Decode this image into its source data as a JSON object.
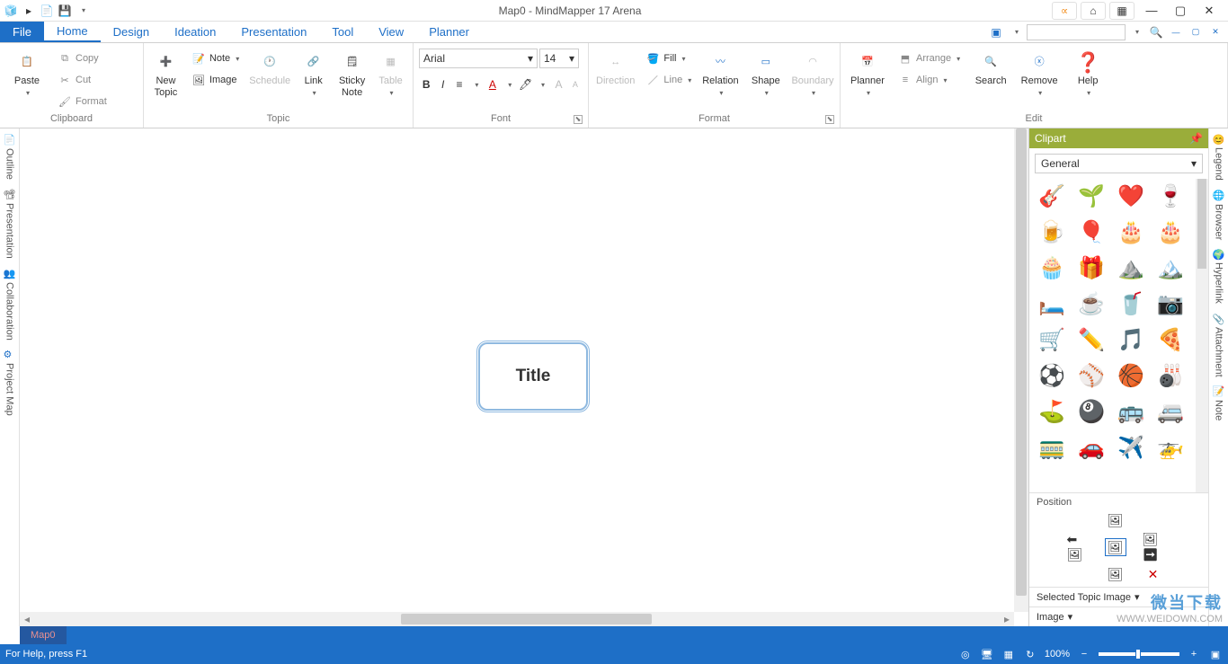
{
  "title": "Map0 - MindMapper 17 Arena",
  "tabs": {
    "file": "File",
    "home": "Home",
    "design": "Design",
    "ideation": "Ideation",
    "presentation": "Presentation",
    "tool": "Tool",
    "view": "View",
    "planner": "Planner"
  },
  "ribbon": {
    "clipboard": {
      "label": "Clipboard",
      "paste": "Paste",
      "copy": "Copy",
      "cut": "Cut",
      "format": "Format"
    },
    "topic": {
      "label": "Topic",
      "new_topic": "New\nTopic",
      "note": "Note",
      "image": "Image",
      "schedule": "Schedule",
      "link": "Link",
      "sticky": "Sticky\nNote",
      "table": "Table"
    },
    "font": {
      "label": "Font",
      "family": "Arial",
      "size": "14"
    },
    "format": {
      "label": "Format",
      "direction": "Direction",
      "fill": "Fill",
      "line": "Line",
      "relation": "Relation",
      "shape": "Shape",
      "boundary": "Boundary"
    },
    "edit": {
      "label": "Edit",
      "planner": "Planner",
      "arrange": "Arrange",
      "align": "Align",
      "search": "Search",
      "remove": "Remove",
      "help": "Help"
    }
  },
  "leftbar": {
    "outline": "Outline",
    "presentation": "Presentation",
    "collaboration": "Collaboration",
    "project": "Project Map"
  },
  "rightbar": {
    "legend": "Legend",
    "browser": "Browser",
    "hyperlink": "Hyperlink",
    "attachment": "Attachment",
    "note": "Note"
  },
  "clipart": {
    "title": "Clipart",
    "category": "General",
    "position": "Position",
    "selected_image": "Selected Topic Image",
    "image": "Image",
    "items": [
      "🎸",
      "🌱",
      "❤️",
      "🍷",
      "🍺",
      "🎈",
      "🎂",
      "🎂",
      "🧁",
      "🎁",
      "⛰️",
      "🏔️",
      "🛏️",
      "☕",
      "🥤",
      "📷",
      "🛒",
      "✏️",
      "🎵",
      "🍕",
      "⚽",
      "⚾",
      "🏀",
      "🎳",
      "⛳",
      "🎱",
      "🚌",
      "🚐",
      "🚃",
      "🚗",
      "✈️",
      "🚁"
    ]
  },
  "canvas": {
    "title": "Title"
  },
  "sheet_tab": "Map0",
  "statusbar": {
    "help": "For Help, press F1",
    "zoom": "100%"
  },
  "watermark": {
    "brand": "微当下载",
    "url": "WWW.WEIDOWN.COM"
  }
}
